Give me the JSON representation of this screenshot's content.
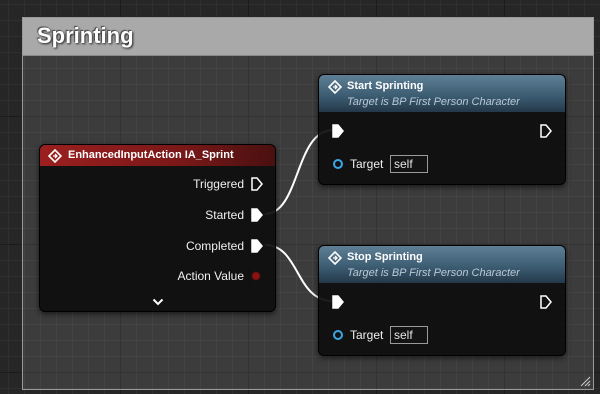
{
  "comment": {
    "title": "Sprinting"
  },
  "event_node": {
    "title": "EnhancedInputAction IA_Sprint",
    "header_color": "#8c1c1c",
    "pins": [
      {
        "label": "Triggered",
        "connected": false
      },
      {
        "label": "Started",
        "connected": true
      },
      {
        "label": "Completed",
        "connected": true
      },
      {
        "label": "Action Value",
        "pin_color": "#8a1414"
      }
    ],
    "expand_icon": "chevron-down-icon"
  },
  "start_node": {
    "title": "Start Sprinting",
    "subtitle": "Target is BP First Person Character",
    "header_color": "#3b5b72",
    "target_label": "Target",
    "target_value": "self"
  },
  "stop_node": {
    "title": "Stop Sprinting",
    "subtitle": "Target is BP First Person Character",
    "header_color": "#3b5b72",
    "target_label": "Target",
    "target_value": "self"
  },
  "colors": {
    "exec_wire": "#ffffff",
    "object_pin": "#3aa8e6"
  }
}
